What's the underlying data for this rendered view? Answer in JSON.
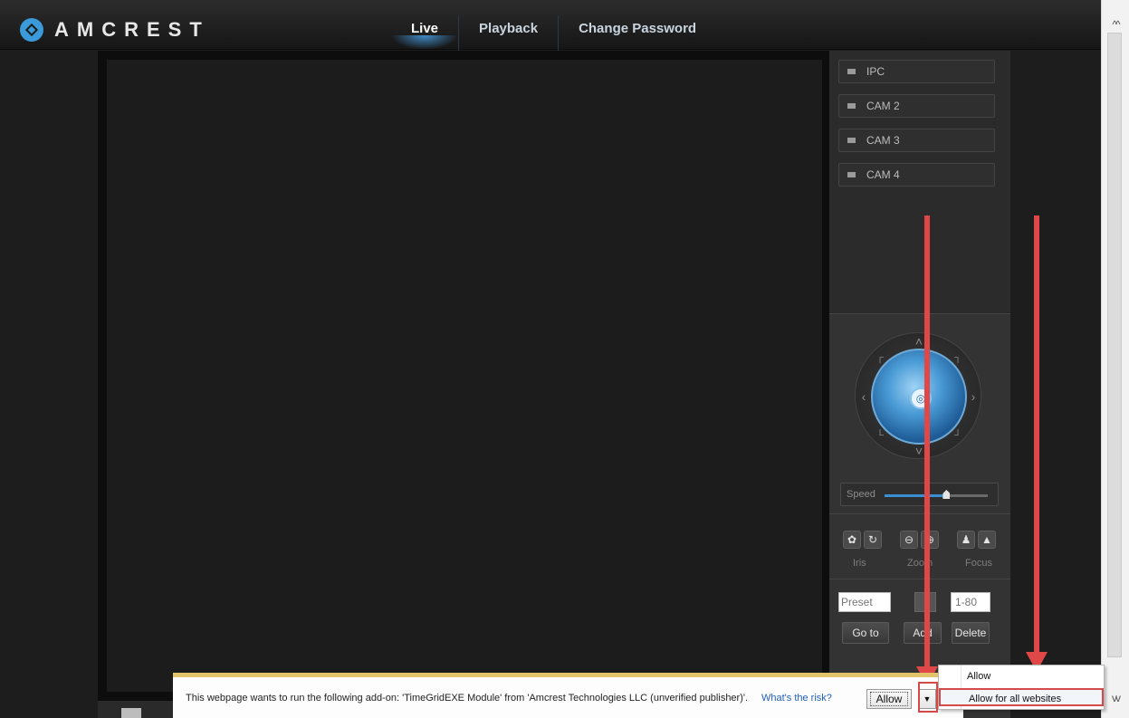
{
  "header": {
    "brand": "AMCREST",
    "nav": [
      "Live",
      "Playback",
      "Change Password"
    ],
    "active_tab": "Live"
  },
  "cameras": [
    "IPC",
    "CAM 2",
    "CAM 3",
    "CAM 4"
  ],
  "ptz": {
    "speed_label": "Speed",
    "speed_value": 0.6,
    "iris_label": "Iris",
    "zoom_label": "Zoom",
    "focus_label": "Focus"
  },
  "preset": {
    "preset_placeholder": "Preset",
    "range_placeholder": "1-80",
    "goto_label": "Go to",
    "add_label": "Add",
    "delete_label": "Delete"
  },
  "notification": {
    "message": "This webpage wants to run the following add-on: 'TimeGridEXE Module' from 'Amcrest Technologies LLC (unverified publisher)'.",
    "risk_link": "What's the risk?",
    "allow_label": "Allow"
  },
  "dropdown": {
    "items": [
      "Allow",
      "Allow for all websites"
    ]
  },
  "colors": {
    "accent": "#3a8fd2",
    "annotation": "#e04848"
  }
}
